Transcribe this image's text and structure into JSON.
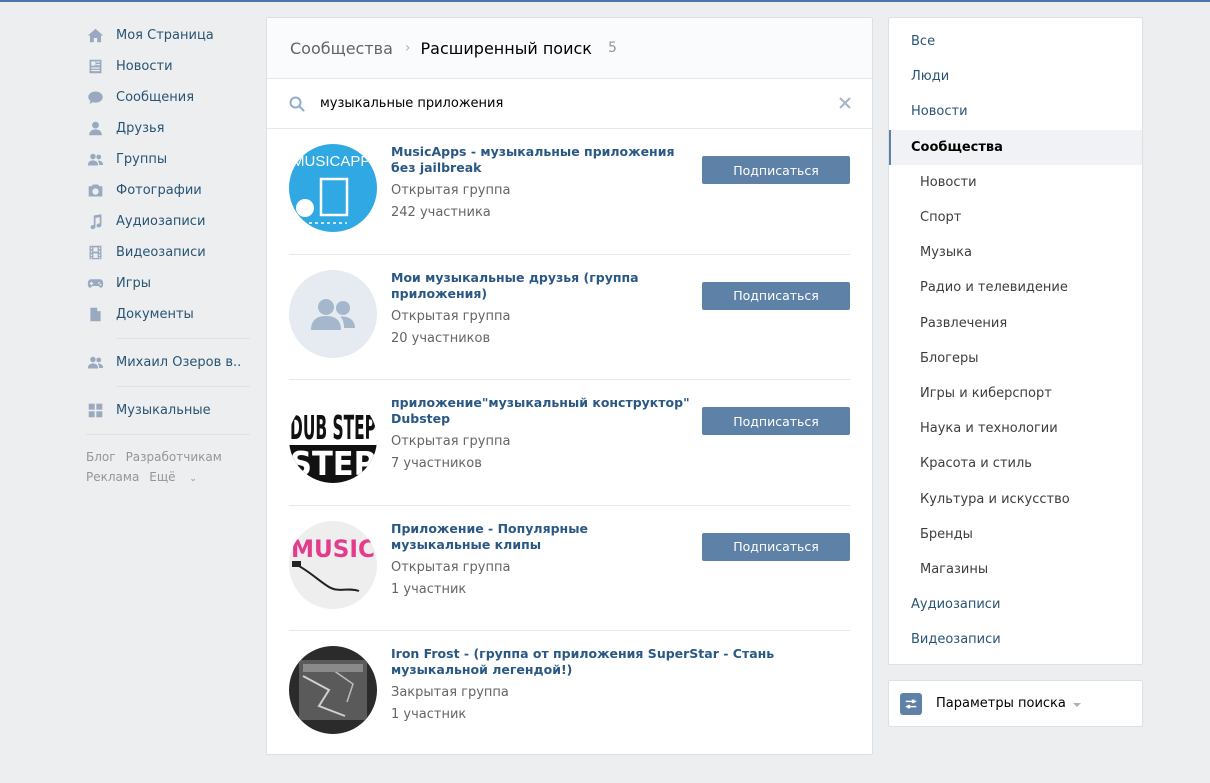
{
  "left_nav": {
    "items": [
      {
        "label": "Моя Страница",
        "icon": "home-icon"
      },
      {
        "label": "Новости",
        "icon": "news-icon"
      },
      {
        "label": "Сообщения",
        "icon": "messages-icon"
      },
      {
        "label": "Друзья",
        "icon": "friends-icon"
      },
      {
        "label": "Группы",
        "icon": "groups-icon"
      },
      {
        "label": "Фотографии",
        "icon": "camera-icon"
      },
      {
        "label": "Аудиозаписи",
        "icon": "music-note-icon"
      },
      {
        "label": "Видеозаписи",
        "icon": "film-icon"
      },
      {
        "label": "Игры",
        "icon": "gamepad-icon"
      },
      {
        "label": "Документы",
        "icon": "document-icon"
      }
    ],
    "group_item": {
      "label": "Михаил Озеров в..",
      "icon": "groups-icon"
    },
    "app_item": {
      "label": "Музыкальные",
      "icon": "apps-grid-icon"
    },
    "footer": {
      "blog": "Блог",
      "developers": "Разработчикам",
      "ads": "Реклама",
      "more": "Ещё"
    }
  },
  "header": {
    "crumb": "Сообщества",
    "current": "Расширенный поиск",
    "count": "5"
  },
  "search": {
    "value": "музыкальные приложения"
  },
  "results": [
    {
      "title": "MusicApps - музыкальные приложения без jailbreak",
      "type": "Открытая группа",
      "members": "242 участника",
      "button": "Подписаться",
      "avatar_text": "MUSICAPP"
    },
    {
      "title": "Мои музыкальные друзья (группа приложения)",
      "type": "Открытая группа",
      "members": "20 участников",
      "button": "Подписаться"
    },
    {
      "title": "приложение\"музыкальный конструктор\" Dubstep",
      "type": "Открытая группа",
      "members": "7 участников",
      "button": "Подписаться",
      "avatar_text": "DUB STEP"
    },
    {
      "title": "Приложение - Популярные музыкальные клипы",
      "type": "Открытая группа",
      "members": "1 участник",
      "button": "Подписаться",
      "avatar_text": "MUSIC"
    },
    {
      "title": "Iron Frost - (группа от приложения SuperStar - Стань музыкальной легендой!)",
      "type": "Закрытая группа",
      "members": "1 участник",
      "button": "Подписаться"
    }
  ],
  "filters": {
    "items": [
      {
        "label": "Все",
        "level": "top"
      },
      {
        "label": "Люди",
        "level": "top"
      },
      {
        "label": "Новости",
        "level": "top"
      },
      {
        "label": "Сообщества",
        "level": "top",
        "active": true
      },
      {
        "label": "Новости",
        "level": "sub"
      },
      {
        "label": "Спорт",
        "level": "sub"
      },
      {
        "label": "Музыка",
        "level": "sub"
      },
      {
        "label": "Радио и телевидение",
        "level": "sub"
      },
      {
        "label": "Развлечения",
        "level": "sub"
      },
      {
        "label": "Блогеры",
        "level": "sub"
      },
      {
        "label": "Игры и киберспорт",
        "level": "sub"
      },
      {
        "label": "Наука и технологии",
        "level": "sub"
      },
      {
        "label": "Красота и стиль",
        "level": "sub"
      },
      {
        "label": "Культура и искусство",
        "level": "sub"
      },
      {
        "label": "Бренды",
        "level": "sub"
      },
      {
        "label": "Магазины",
        "level": "sub"
      },
      {
        "label": "Аудиозаписи",
        "level": "top"
      },
      {
        "label": "Видеозаписи",
        "level": "top"
      }
    ],
    "params_label": "Параметры поиска"
  },
  "colors": {
    "accent": "#5e81a8",
    "link": "#2a5885",
    "background": "#edeef0"
  }
}
